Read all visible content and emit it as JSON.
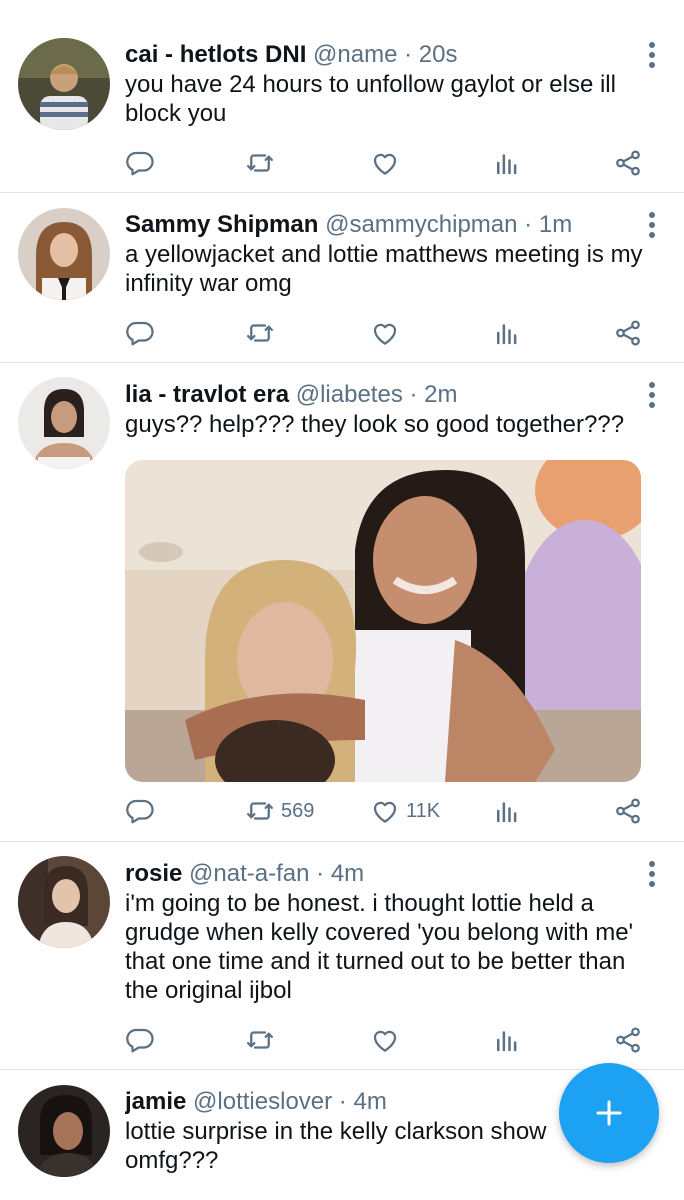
{
  "tweets": [
    {
      "name": "cai - hetlots DNI",
      "handle": "@name",
      "separator": "·",
      "time": "20s",
      "text": "you have 24 hours to unfollow gaylot or else ill block you",
      "retweets": "",
      "likes": ""
    },
    {
      "name": "Sammy Shipman",
      "handle": "@sammychipman",
      "separator": "·",
      "time": "1m",
      "text": "a yellowjacket and lottie matthews meeting is my infinity war omg",
      "retweets": "",
      "likes": ""
    },
    {
      "name": "lia - travlot era",
      "handle": "@liabetes",
      "separator": "·",
      "time": "2m",
      "text": "guys?? help??? they look so good together???",
      "retweets": "569",
      "likes": "11K"
    },
    {
      "name": "rosie",
      "handle": "@nat-a-fan",
      "separator": "·",
      "time": "4m",
      "text": "i'm going to be honest. i thought lottie held a grudge when kelly covered 'you belong with me' that one time and it turned out to be better than the original ijbol",
      "retweets": "",
      "likes": ""
    },
    {
      "name": "jamie",
      "handle": "@lottieslover",
      "separator": "·",
      "time": "4m",
      "text": "lottie surprise in the kelly clarkson show omfg???"
    }
  ],
  "icons": {
    "reply": "reply-icon",
    "retweet": "retweet-icon",
    "like": "heart-icon",
    "analytics": "analytics-icon",
    "share": "share-icon",
    "more": "more-vertical-icon",
    "compose": "plus-icon"
  },
  "colors": {
    "accent": "#1da1f2",
    "secondary_text": "#5b7083",
    "divider": "#dfe3e6"
  }
}
